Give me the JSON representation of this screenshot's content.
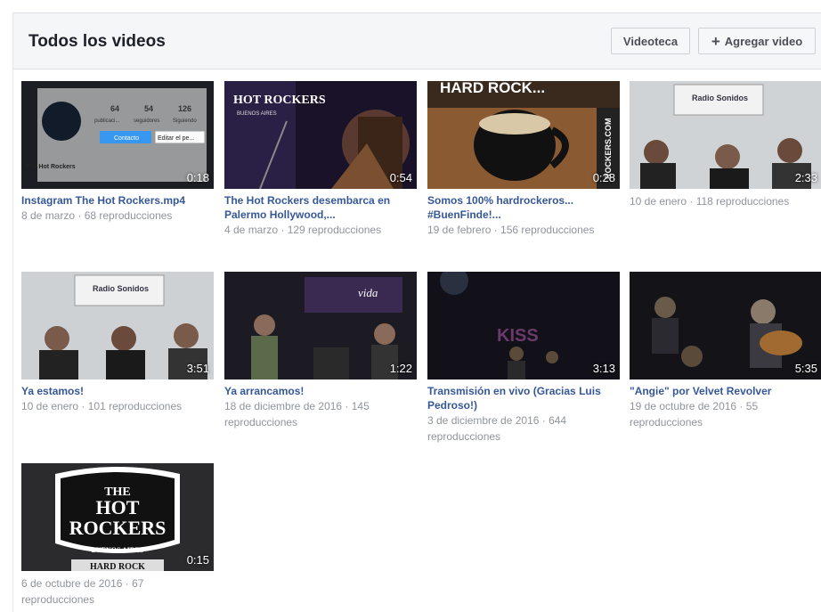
{
  "header": {
    "title": "Todos los videos",
    "library_button": "Videoteca",
    "add_button": "Agregar video"
  },
  "videos": [
    {
      "title": "Instagram The Hot Rockers.mp4",
      "meta": "8 de marzo · 68 reproducciones",
      "duration": "0:18",
      "thumb_text": {
        "stats": [
          "64",
          "54",
          "126"
        ],
        "stat_labels": [
          "publicaci...",
          "seguidores",
          "Siguiendo"
        ],
        "contact": "Contacto",
        "edit": "Editar el pe...",
        "profile": "The Hot Rockers"
      }
    },
    {
      "title": "The Hot Rockers desembarca en Palermo Hollywood,...",
      "meta": "4 de marzo · 129 reproducciones",
      "duration": "0:54",
      "thumb_text": {
        "logo": "HOT ROCKERS",
        "sub": "BUENOS AIRES"
      }
    },
    {
      "title": "Somos 100% hardrockeros... #BuenFinde!...",
      "meta": "19 de febrero · 156 reproducciones",
      "duration": "0:28",
      "thumb_text": {
        "top": "HARD ROCK...",
        "side": "ROCKERS.COM"
      }
    },
    {
      "title": "",
      "meta": "10 de enero · 118 reproducciones",
      "duration": "2:33",
      "thumb_text": {
        "sign": "Radio Sonidos"
      }
    },
    {
      "title": "Ya estamos!",
      "meta": "10 de enero · 101 reproducciones",
      "duration": "3:51",
      "thumb_text": {
        "sign": "Radio Sonidos"
      }
    },
    {
      "title": "Ya arrancamos!",
      "meta": "18 de diciembre de 2016 · 145 reproducciones",
      "duration": "1:22",
      "thumb_text": {
        "sign": "vida"
      }
    },
    {
      "title": "Transmisión en vivo (Gracias Luis Pedroso!)",
      "meta": "3 de diciembre de 2016 · 644 reproducciones",
      "duration": "3:13",
      "thumb_text": {
        "sign": "KISS"
      }
    },
    {
      "title": "\"Angie\" por Velvet Revolver",
      "meta": "19 de octubre de 2016 · 55 reproducciones",
      "duration": "5:35",
      "thumb_text": {}
    },
    {
      "title": "",
      "meta": "6 de octubre de 2016 · 67 reproducciones",
      "duration": "0:15",
      "thumb_text": {
        "line1": "THE",
        "line2": "HOT",
        "line3": "ROCKERS",
        "line4": "BUENOS AIRES",
        "line5": "HARD ROCK"
      }
    }
  ]
}
